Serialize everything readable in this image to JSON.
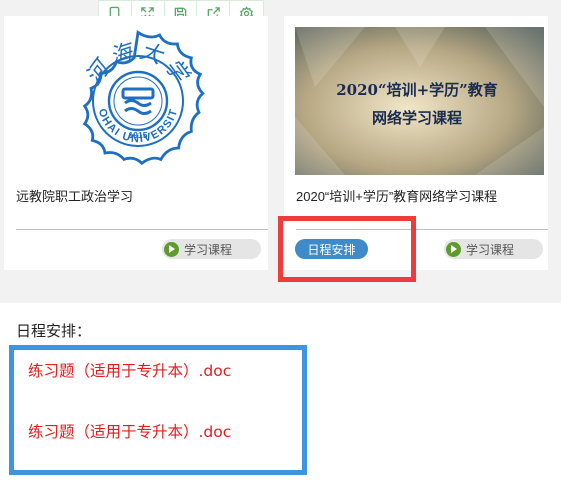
{
  "toolbar": {
    "icons": [
      "tablet-icon",
      "fullscreen-icon",
      "save-icon",
      "share-icon",
      "settings-icon"
    ]
  },
  "courses": [
    {
      "title": "远教院职工政治学习",
      "logo": {
        "seal_text": "HOHAI UNIVERSITY",
        "year": "1915",
        "calligraphy": "河海大学"
      },
      "study_label": "学习课程"
    },
    {
      "title": "2020“培训+学历”教育网络学习课程",
      "banner": {
        "line1": "2020“培训+学历”教育",
        "line2": "网络学习课程"
      },
      "schedule_label": "日程安排",
      "study_label": "学习课程"
    }
  ],
  "schedule": {
    "heading": "日程安排：",
    "files": [
      "练习题（适用于专升本）.doc",
      "练习题（适用于专升本）.doc"
    ]
  },
  "colors": {
    "logo_blue": "#1f6fc0",
    "play_green": "#5f9a2c",
    "schedule_blue": "#3f8ac8",
    "highlight_red": "#ee3b3b",
    "highlight_blue": "#3d95e0",
    "link_red": "#e51c1c"
  }
}
